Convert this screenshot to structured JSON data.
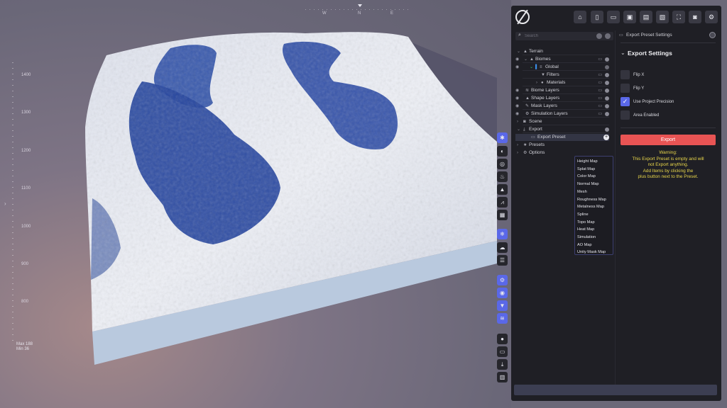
{
  "viewport": {
    "compass": {
      "w": "W",
      "n": "N",
      "e": "E"
    },
    "ruler_labels": [
      "1400",
      "1300",
      "1200",
      "1100",
      "1000",
      "900",
      "800"
    ],
    "minmax": {
      "max": "Max 188",
      "min": "Min 36"
    }
  },
  "toolbar": {
    "icons": [
      "home-icon",
      "new-file-icon",
      "open-folder-icon",
      "save-icon",
      "save-as-icon",
      "export-file-icon",
      "fullscreen-icon",
      "camera-icon",
      "settings-icon"
    ]
  },
  "tree": {
    "search_placeholder": "Search",
    "rows": [
      {
        "label": "Terrain"
      },
      {
        "label": "Biomes"
      },
      {
        "label": "Global"
      },
      {
        "label": "Filters"
      },
      {
        "label": "Materials"
      },
      {
        "label": "Biome Layers"
      },
      {
        "label": "Shape Layers"
      },
      {
        "label": "Mask Layers"
      },
      {
        "label": "Simulation Layers"
      },
      {
        "label": "Scene"
      },
      {
        "label": "Export"
      },
      {
        "label": "Export Preset"
      },
      {
        "label": "Presets"
      },
      {
        "label": "Options"
      }
    ],
    "dropdown_items": [
      "Height Map",
      "Splat Map",
      "Color Map",
      "Normal Map",
      "Mesh",
      "Roughness Map",
      "Metalness Map",
      "Spline",
      "Topo Map",
      "Heat Map",
      "Simulation",
      "AO Map",
      "Unity Mask Map"
    ]
  },
  "props": {
    "header": "Export Preset Settings",
    "title": "Export Settings",
    "options": [
      {
        "label": "Flip X",
        "checked": false
      },
      {
        "label": "Flip Y",
        "checked": false
      },
      {
        "label": "Use Project Precision",
        "checked": true
      },
      {
        "label": "Area Enabled",
        "checked": false
      }
    ],
    "export_label": "Export",
    "warning": [
      "Warning:",
      "This Export Preset is empty and will",
      "not Export anything.",
      "Add Items by clicking the",
      "plus button next to the Preset."
    ]
  },
  "colors": {
    "accent": "#5a68e8",
    "export": "#e85454",
    "warning": "#e8d64a",
    "panel": "#1f1f25"
  }
}
